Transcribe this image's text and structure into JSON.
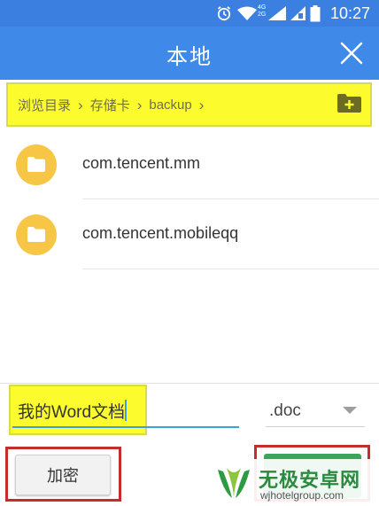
{
  "status_bar": {
    "time": "10:27",
    "network_label_top": "4G",
    "network_label_bottom": "2G",
    "icons": [
      "alarm-icon",
      "wifi-icon",
      "signal-icon",
      "sim-icon",
      "battery-icon"
    ]
  },
  "app_bar": {
    "title": "本地",
    "close_icon": "close-icon"
  },
  "breadcrumb": {
    "items": [
      "浏览目录",
      "存储卡",
      "backup"
    ],
    "separator": "›",
    "new_folder_icon": "new-folder-icon"
  },
  "files": [
    {
      "name": "com.tencent.mm",
      "icon": "folder-icon"
    },
    {
      "name": "com.tencent.mobileqq",
      "icon": "folder-icon"
    }
  ],
  "save_form": {
    "file_name": "我的Word文档",
    "extension": ".doc",
    "encrypt_label": "加密",
    "confirm_label": ""
  },
  "watermark": {
    "title": "无极安卓网",
    "url": "wjhotelgroup.com"
  },
  "colors": {
    "app_bar": "#3f8ae8",
    "highlight": "#fbfb2e",
    "folder": "#f7c646",
    "annotation_box": "#c52c2c",
    "confirm_button": "#3ba55c",
    "input_underline": "#39a1df"
  }
}
